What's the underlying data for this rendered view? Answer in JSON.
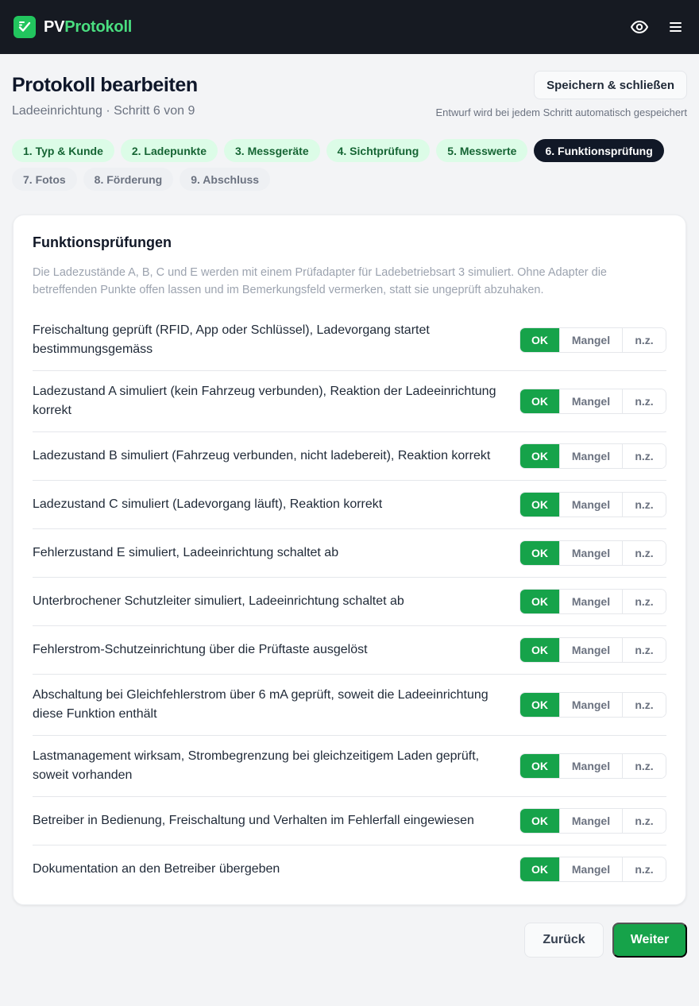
{
  "app": {
    "brand_part1": "PV",
    "brand_part2": "Protokoll",
    "accent_color": "#22c55e",
    "icons": [
      "logo-icon",
      "eye-icon",
      "menu-icon"
    ]
  },
  "header": {
    "title": "Protokoll bearbeiten",
    "subtitle": "Ladeeinrichtung · Schritt 6 von 9",
    "save_label": "Speichern & schließen",
    "autosave_note": "Entwurf wird bei jedem Schritt automatisch gespeichert"
  },
  "steps": [
    {
      "label": "1. Typ & Kunde",
      "state": "done"
    },
    {
      "label": "2. Ladepunkte",
      "state": "done"
    },
    {
      "label": "3. Messgeräte",
      "state": "done"
    },
    {
      "label": "4. Sichtprüfung",
      "state": "done"
    },
    {
      "label": "5. Messwerte",
      "state": "done"
    },
    {
      "label": "6. Funktionsprüfung",
      "state": "active"
    },
    {
      "label": "7. Fotos",
      "state": "todo"
    },
    {
      "label": "8. Förderung",
      "state": "todo"
    },
    {
      "label": "9. Abschluss",
      "state": "todo"
    }
  ],
  "card": {
    "title": "Funktionsprüfungen",
    "description": "Die Ladezustände A, B, C und E werden mit einem Prüfadapter für Ladebetriebsart 3 simuliert. Ohne Adapter die betreffenden Punkte offen lassen und im Bemerkungsfeld vermerken, statt sie ungeprüft abzuhaken.",
    "options": {
      "ok": "OK",
      "mangel": "Mangel",
      "nz": "n.z."
    },
    "items": [
      {
        "label": "Freischaltung geprüft (RFID, App oder Schlüssel), Ladevorgang startet bestimmungsgemäss",
        "selected": "OK"
      },
      {
        "label": "Ladezustand A simuliert (kein Fahrzeug verbunden), Reaktion der Ladeeinrichtung korrekt",
        "selected": "OK"
      },
      {
        "label": "Ladezustand B simuliert (Fahrzeug verbunden, nicht ladebereit), Reaktion korrekt",
        "selected": "OK"
      },
      {
        "label": "Ladezustand C simuliert (Ladevorgang läuft), Reaktion korrekt",
        "selected": "OK"
      },
      {
        "label": "Fehlerzustand E simuliert, Ladeeinrichtung schaltet ab",
        "selected": "OK"
      },
      {
        "label": "Unterbrochener Schutzleiter simuliert, Ladeeinrichtung schaltet ab",
        "selected": "OK"
      },
      {
        "label": "Fehlerstrom-Schutzeinrichtung über die Prüftaste ausgelöst",
        "selected": "OK"
      },
      {
        "label": "Abschaltung bei Gleichfehlerstrom über 6 mA geprüft, soweit die Ladeeinrichtung diese Funktion enthält",
        "selected": "OK"
      },
      {
        "label": "Lastmanagement wirksam, Strombegrenzung bei gleichzeitigem Laden geprüft, soweit vorhanden",
        "selected": "OK"
      },
      {
        "label": "Betreiber in Bedienung, Freischaltung und Verhalten im Fehlerfall eingewiesen",
        "selected": "OK"
      },
      {
        "label": "Dokumentation an den Betreiber übergeben",
        "selected": "OK"
      }
    ]
  },
  "footer": {
    "back_label": "Zurück",
    "next_label": "Weiter"
  }
}
